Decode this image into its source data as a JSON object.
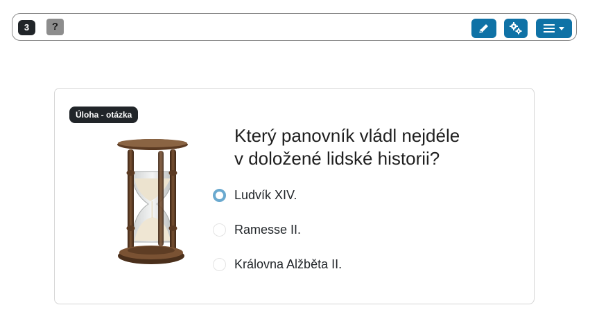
{
  "toolbar": {
    "counter": "3",
    "help_label": "?",
    "edit_icon": "pencil-icon",
    "settings_icon": "gears-icon",
    "menu_icon": "hamburger-icon",
    "accent_color": "#0f72a6"
  },
  "card": {
    "badge": "Úloha - otázka",
    "image_icon": "hourglass-image",
    "question_line1": "Který panovník vládl nejdéle",
    "question_line2": "v doložené lidské historii?",
    "options": [
      {
        "label": "Ludvík XIV.",
        "selected": true
      },
      {
        "label": "Ramesse II.",
        "selected": false
      },
      {
        "label": "Královna Alžběta II.",
        "selected": false
      }
    ],
    "selected_color": "#6aa9cf"
  }
}
